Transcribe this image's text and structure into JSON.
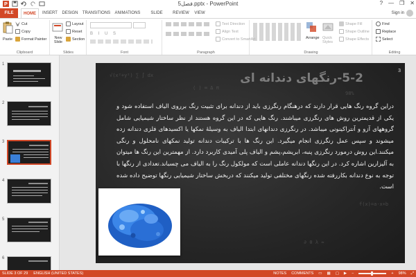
{
  "window": {
    "title": "فصل5.pptx - PowerPoint",
    "controls": [
      "?",
      "—",
      "❐",
      "✕"
    ]
  },
  "tabs": [
    {
      "label": "FILE"
    },
    {
      "label": "HOME"
    },
    {
      "label": "INSERT"
    },
    {
      "label": "DESIGN"
    },
    {
      "label": "TRANSITIONS"
    },
    {
      "label": "ANIMATIONS"
    },
    {
      "label": "SLIDE SHOW"
    },
    {
      "label": "REVIEW"
    },
    {
      "label": "VIEW"
    }
  ],
  "signin": {
    "label": "Sign in"
  },
  "ribbon": {
    "clipboard": {
      "label": "Clipboard",
      "paste": "Paste",
      "cut": "Cut",
      "copy": "Copy",
      "format_painter": "Format Painter"
    },
    "slides": {
      "label": "Slides",
      "new_slide": "New Slide",
      "layout": "Layout",
      "reset": "Reset",
      "section": "Section"
    },
    "font": {
      "label": "Font"
    },
    "paragraph": {
      "label": "Paragraph",
      "text_direction": "Text Direction",
      "align_text": "Align Text",
      "convert_smartart": "Convert to SmartArt"
    },
    "drawing": {
      "label": "Drawing",
      "arrange": "Arrange",
      "quick_styles": "Quick Styles",
      "shape_fill": "Shape Fill",
      "shape_outline": "Shape Outline",
      "shape_effects": "Shape Effects"
    },
    "editing": {
      "label": "Editing",
      "find": "Find",
      "replace": "Replace",
      "select": "Select"
    }
  },
  "thumbnails": [
    {
      "num": "1"
    },
    {
      "num": "2"
    },
    {
      "num": "3"
    },
    {
      "num": "4"
    },
    {
      "num": "5"
    },
    {
      "num": "6"
    }
  ],
  "slide": {
    "number": "3",
    "title": "5-2-رنگهای دندانه ای",
    "body": "دراین گروه رنگ هایی قرار دارند که درهنگام رنگرزی باید از دندانه برای تثبیت رنگ برروی الیاف استفاده شود و یکی از قدیمترین روش های رنگرزی میباشند. رنگ هایی که در این گروه هستند از نظر ساختار شیمیایی شامل گروههای آزو و آنتراکینونی میباشد. در رنگرزی دندانهای ابتدا الیاف به وسیلهٔ نمکها یا اکسیدهای فلزی دندانه زده میشوند و سپس عمل رنگرزی انجام  میگیرد. این رنگ ها با ترکیبات دندانه تولید نمکهای نامحلول و رنگی میکنند.این روش درمورد رنگرزی پنبه، ابریشم،پشم و الیاف پلی آمیدی کاربرد دارد. از مهمترین این رنگ ها میتوان  به آلیزارین اشاره کرد. در این رنگها دندانه عاملی است که مولکول رنگ را به الیاف می چسباند.تعدادی از رنگها با توجه به نوع دندانه  بکاررفته شده رنگهای مختلفی تولید میکنند که دربخش ساختار شیمیایی رنگها توضیح داده شده است."
  },
  "status": {
    "slide_of": "SLIDE 3 OF 29",
    "language": "ENGLISH (UNITED STATES)",
    "notes": "NOTES",
    "comments": "COMMENTS",
    "zoom": "98%",
    "zoom_fraction": 0.49
  },
  "colors": {
    "accent": "#d24726"
  }
}
